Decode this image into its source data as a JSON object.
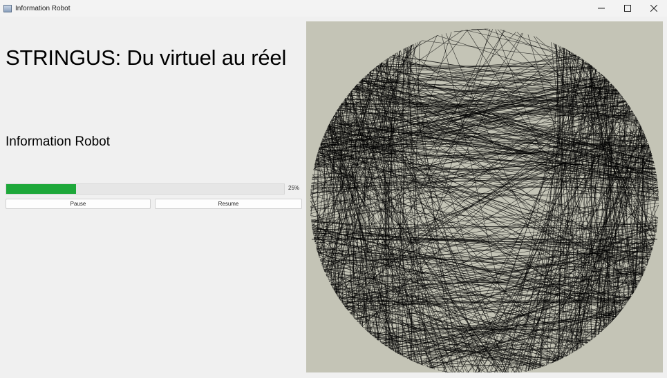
{
  "window": {
    "title": "Information Robot",
    "controls": {
      "minimize_icon": "minimize-icon",
      "maximize_icon": "maximize-icon",
      "close_icon": "close-icon"
    }
  },
  "main": {
    "headline": "STRINGUS: Du virtuel au réel",
    "subhead": "Information Robot",
    "progress": {
      "value": 0.25,
      "label": "25%",
      "fill_color": "#1ea83a"
    },
    "buttons": {
      "pause": "Pause",
      "resume": "Resume"
    }
  },
  "canvas": {
    "background": "#c4c4b6",
    "line_color": "#000000",
    "content": "string-art-circle"
  }
}
